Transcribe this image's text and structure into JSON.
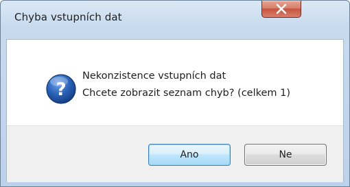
{
  "dialog": {
    "title": "Chyba vstupních dat",
    "message_line1": "Nekonzistence vstupních dat",
    "message_line2": "Chcete zobrazit seznam chyb? (celkem 1)",
    "icon": "question-icon",
    "close_icon": "close-icon",
    "buttons": {
      "yes_label": "Ano",
      "no_label": "Ne"
    }
  },
  "colors": {
    "close_button": "#c5553f",
    "icon_blue": "#2a63b8",
    "default_button_border": "#3c7fb1"
  }
}
